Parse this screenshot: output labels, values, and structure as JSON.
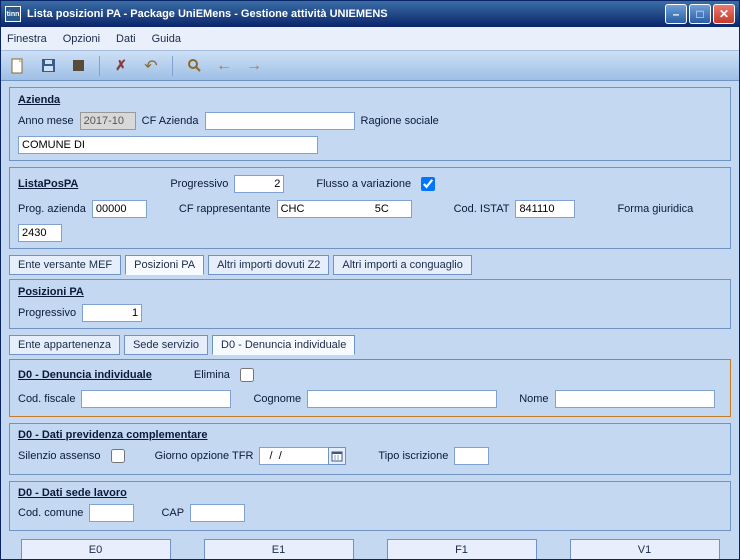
{
  "window": {
    "title": "Lista posizioni PA - Package UniEMens - Gestione attività UNIEMENS",
    "app_abbrev": "tinn"
  },
  "menubar": {
    "finestra": "Finestra",
    "opzioni": "Opzioni",
    "dati": "Dati",
    "guida": "Guida"
  },
  "azienda": {
    "title": "Azienda",
    "anno_mese_label": "Anno mese",
    "anno_mese": "2017-10",
    "cf_azienda_label": "CF Azienda",
    "cf_azienda": "",
    "ragione_sociale_label": "Ragione sociale",
    "ragione_sociale": "COMUNE DI"
  },
  "listapospa": {
    "title": "ListaPosPA",
    "progressivo_label": "Progressivo",
    "progressivo": "2",
    "flusso_label": "Flusso a variazione",
    "prog_azienda_label": "Prog. azienda",
    "prog_azienda": "00000",
    "cf_rapp_label": "CF rappresentante",
    "cf_rapp": "CHC                       5C",
    "cod_istat_label": "Cod. ISTAT",
    "cod_istat": "841110",
    "forma_giur_label": "Forma giuridica",
    "forma_giur": "2430"
  },
  "tabs1": {
    "ente": "Ente versante MEF",
    "posizioni": "Posizioni PA",
    "altri_z2": "Altri importi dovuti Z2",
    "altri_cong": "Altri importi a conguaglio"
  },
  "posizionipa": {
    "title": "Posizioni PA",
    "progressivo_label": "Progressivo",
    "progressivo": "1"
  },
  "tabs2": {
    "ente_app": "Ente appartenenza",
    "sede_serv": "Sede servizio",
    "d0": "D0 - Denuncia individuale"
  },
  "d0_denuncia": {
    "title": "D0 - Denuncia individuale",
    "elimina_label": "Elimina",
    "cod_fiscale_label": "Cod. fiscale",
    "cod_fiscale": "",
    "cognome_label": "Cognome",
    "cognome": "",
    "nome_label": "Nome",
    "nome": ""
  },
  "d0_prev": {
    "title": "D0 - Dati previdenza complementare",
    "silenzio_label": "Silenzio assenso",
    "giorno_label": "Giorno opzione TFR",
    "giorno": "  /  /",
    "tipo_iscr_label": "Tipo iscrizione",
    "tipo_iscr": ""
  },
  "d0_sede": {
    "title": "D0 - Dati sede lavoro",
    "cod_comune_label": "Cod. comune",
    "cod_comune": "",
    "cap_label": "CAP",
    "cap": ""
  },
  "buttons": {
    "e0": "E0",
    "e1": "E1",
    "f1": "F1",
    "v1": "V1"
  }
}
